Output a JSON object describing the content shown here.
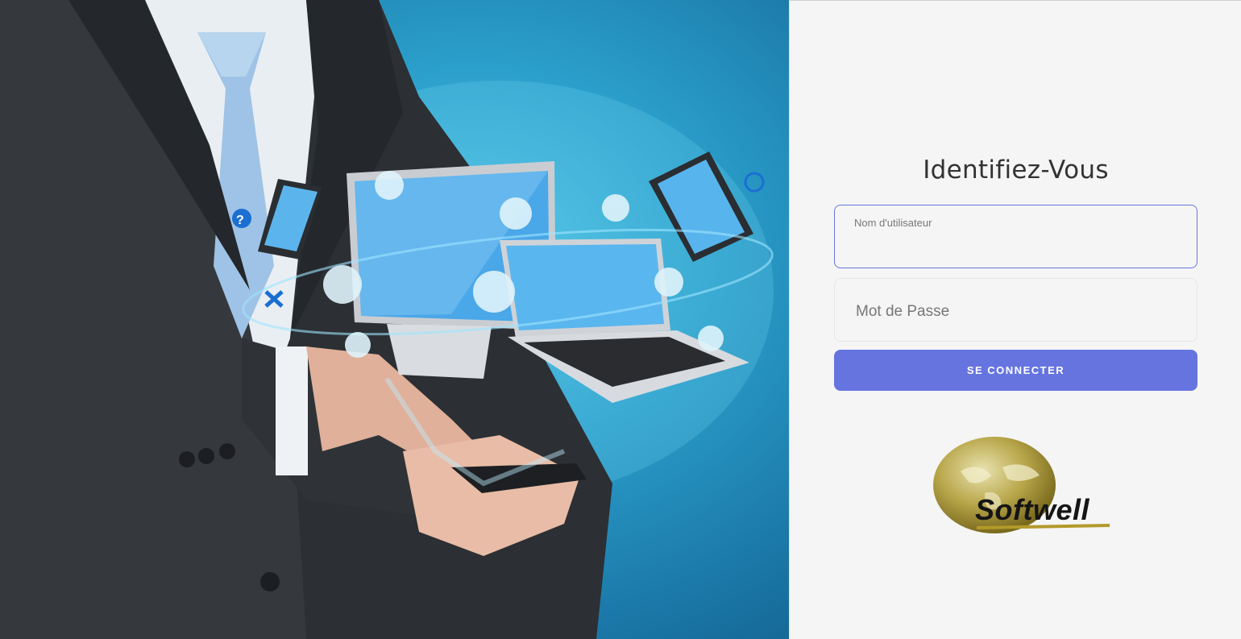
{
  "login": {
    "title": "Identifiez-Vous",
    "username": {
      "label": "Nom d'utilisateur",
      "value": ""
    },
    "password": {
      "placeholder": "Mot de Passe",
      "value": ""
    },
    "submit_label": "SE CONNECTER"
  },
  "logo": {
    "text": "Softwell"
  },
  "colors": {
    "accent": "#6674df",
    "focus_border": "#6677dd",
    "background": "#f5f5f5",
    "hero_blue": "#2b9fcb"
  },
  "hero": {
    "description_icons": [
      "help-icon",
      "cart-icon",
      "download-icon",
      "globe-icon",
      "mail-icon",
      "camera-icon",
      "search-icon",
      "video-icon",
      "phone-icon",
      "cloud-icon"
    ]
  }
}
